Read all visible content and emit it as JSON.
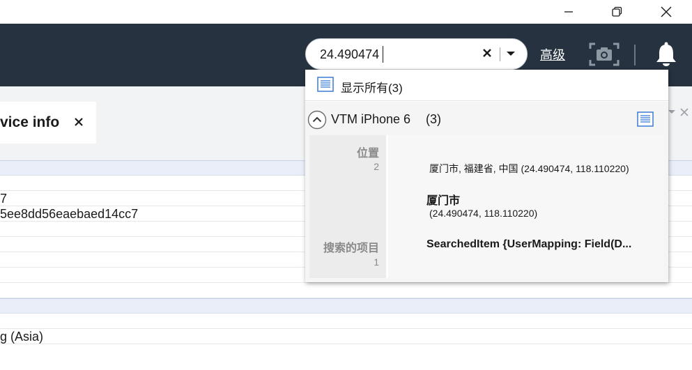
{
  "window_controls": {
    "minimize_icon": "minimize-icon",
    "restore_icon": "restore-icon",
    "close_icon": "close-icon"
  },
  "toolbar": {
    "search": {
      "value": "24.490474",
      "placeholder": ""
    },
    "advanced_label": "高级",
    "icons": [
      "camera-icon",
      "bell-icon"
    ]
  },
  "tab": {
    "label": "vice info",
    "close_icon": "close-icon"
  },
  "table_rows": [
    {
      "text": "",
      "section": true
    },
    {
      "text": "",
      "section": false
    },
    {
      "text": "7",
      "section": false
    },
    {
      "text": "5ee8dd56eaebaed14cc7",
      "section": false
    },
    {
      "text": "",
      "section": false
    },
    {
      "text": "",
      "section": false
    },
    {
      "text": "",
      "section": false
    },
    {
      "text": "",
      "section": false
    },
    {
      "text": "",
      "section": false
    },
    {
      "text": "",
      "section": true
    },
    {
      "text": "",
      "section": false
    },
    {
      "text": "g  (Asia)",
      "section": false
    }
  ],
  "popup": {
    "show_all_label": "显示所有(3)",
    "group": {
      "title": "VTM iPhone 6",
      "count": "(3)"
    },
    "categories": [
      {
        "label": "位置",
        "count": "2"
      },
      {
        "label": "搜索的项目",
        "count": "1"
      }
    ],
    "results": {
      "location_full": "厦门市, 福建省, 中国 (24.490474, 118.110220)",
      "location_name": "厦门市",
      "location_coords": "(24.490474, 118.110220)",
      "searched_item": "SearchedItem {UserMapping: Field(D..."
    }
  },
  "colors": {
    "toolbar_bg": "#26323f",
    "section_row_bg": "#e9eef8",
    "content_bg": "#f2f3f5",
    "list_icon_blue": "#3a7bd5"
  }
}
